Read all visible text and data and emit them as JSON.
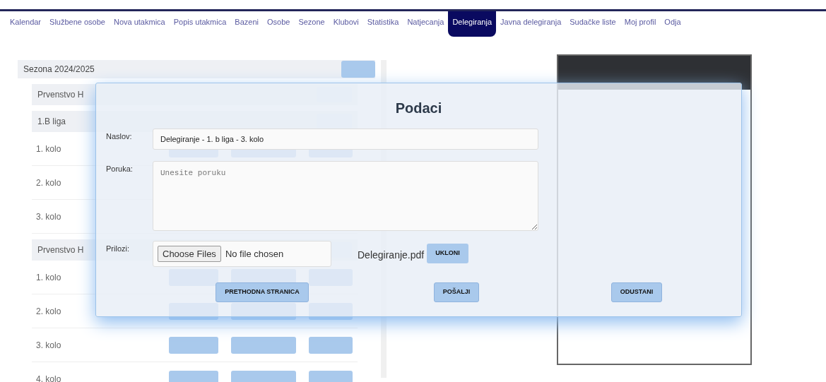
{
  "nav": [
    {
      "label": "Kalendar",
      "selected": false
    },
    {
      "label": "Službene osobe",
      "selected": false
    },
    {
      "label": "Nova utakmica",
      "selected": false
    },
    {
      "label": "Popis utakmica",
      "selected": false
    },
    {
      "label": "Bazeni",
      "selected": false
    },
    {
      "label": "Osobe",
      "selected": false
    },
    {
      "label": "Sezone",
      "selected": false
    },
    {
      "label": "Klubovi",
      "selected": false
    },
    {
      "label": "Statistika",
      "selected": false
    },
    {
      "label": "Natjecanja",
      "selected": false
    },
    {
      "label": "Delegiranja",
      "selected": true
    },
    {
      "label": "Javna delegiranja",
      "selected": false
    },
    {
      "label": "Sudačke liste",
      "selected": false
    },
    {
      "label": "Moj profil",
      "selected": false
    },
    {
      "label": "Odja",
      "selected": false
    }
  ],
  "season": {
    "label": "Sezona 2024/2025"
  },
  "rows": [
    {
      "kind": "group",
      "label": "Prvenstvo H"
    },
    {
      "kind": "group",
      "label": "1.B liga"
    },
    {
      "kind": "round",
      "label": "1. kolo"
    },
    {
      "kind": "round",
      "label": "2. kolo"
    },
    {
      "kind": "round",
      "label": "3. kolo"
    },
    {
      "kind": "group",
      "label": "Prvenstvo H"
    },
    {
      "kind": "round",
      "label": "1. kolo"
    },
    {
      "kind": "round",
      "label": "2. kolo"
    },
    {
      "kind": "round",
      "label": "3. kolo"
    },
    {
      "kind": "round",
      "label": "4. kolo"
    }
  ],
  "modal": {
    "title": "Podaci",
    "title_field": {
      "label": "Naslov:",
      "value": "Delegiranje - 1. b liga - 3. kolo"
    },
    "message_field": {
      "label": "Poruka:",
      "placeholder": "Unesite poruku"
    },
    "attachments": {
      "label": "Prilozi:",
      "choose": "Choose Files",
      "status": "No file chosen",
      "file": "Delegiranje.pdf",
      "remove": "UKLONI"
    },
    "buttons": [
      "PRETHODNA STRANICA",
      "POŠALJI",
      "ODUSTANI"
    ]
  }
}
